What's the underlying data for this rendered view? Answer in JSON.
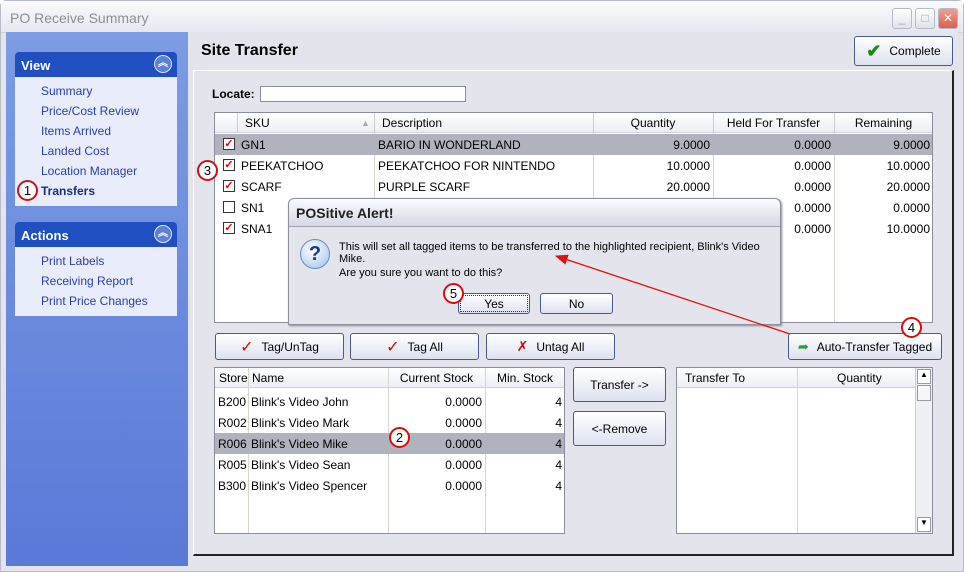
{
  "window": {
    "title": "PO Receive Summary"
  },
  "sidebar": {
    "view": {
      "title": "View",
      "items": [
        "Summary",
        "Price/Cost Review",
        "Items Arrived",
        "Landed Cost",
        "Location Manager",
        "Transfers"
      ]
    },
    "actions": {
      "title": "Actions",
      "items": [
        "Print Labels",
        "Receiving Report",
        "Print Price Changes"
      ]
    }
  },
  "main": {
    "title": "Site Transfer",
    "complete_label": "Complete",
    "locate_label": "Locate:",
    "locate_value": "",
    "items_grid": {
      "columns": [
        "SKU",
        "Description",
        "Quantity",
        "Held For Transfer",
        "Remaining"
      ],
      "rows": [
        {
          "checked": true,
          "sku": "GN1",
          "description": "BARIO IN WONDERLAND",
          "quantity": "9.0000",
          "held": "0.0000",
          "remaining": "9.0000",
          "selected": true
        },
        {
          "checked": true,
          "sku": "PEEKATCHOO",
          "description": "PEEKATCHOO FOR NINTENDO",
          "quantity": "10.0000",
          "held": "0.0000",
          "remaining": "10.0000"
        },
        {
          "checked": true,
          "sku": "SCARF",
          "description": "PURPLE SCARF",
          "quantity": "20.0000",
          "held": "0.0000",
          "remaining": "20.0000"
        },
        {
          "checked": false,
          "sku": "SN1",
          "description": "",
          "quantity": "",
          "held": "0.0000",
          "remaining": "0.0000"
        },
        {
          "checked": true,
          "sku": "SNA1",
          "description": "",
          "quantity": "",
          "held": "0.0000",
          "remaining": "10.0000"
        }
      ]
    },
    "buttons": {
      "tag_untag": "Tag/UnTag",
      "tag_all": "Tag All",
      "untag_all": "Untag All",
      "auto_transfer": "Auto-Transfer Tagged",
      "transfer": "Transfer ->",
      "remove": "<-Remove"
    },
    "stores_grid": {
      "columns": [
        "Store",
        "Name",
        "Current Stock",
        "Min. Stock"
      ],
      "rows": [
        {
          "store": "B200",
          "name": "Blink's Video John",
          "stock": "0.0000",
          "min": "4"
        },
        {
          "store": "R002",
          "name": "Blink's Video Mark",
          "stock": "0.0000",
          "min": "4"
        },
        {
          "store": "R006",
          "name": "Blink's Video Mike",
          "stock": "0.0000",
          "min": "4",
          "selected": true
        },
        {
          "store": "R005",
          "name": "Blink's Video Sean",
          "stock": "0.0000",
          "min": "4"
        },
        {
          "store": "B300",
          "name": "Blink's Video Spencer",
          "stock": "0.0000",
          "min": "4"
        }
      ]
    },
    "transfer_grid": {
      "columns": [
        "Transfer To",
        "Quantity"
      ]
    }
  },
  "dialog": {
    "title": "POSitive Alert!",
    "message": "This will set all tagged items to be transferred to the highlighted recipient, Blink's Video Mike.",
    "question": "Are you sure you want to do this?",
    "yes": "Yes",
    "no": "No",
    "icon": "question-icon"
  },
  "annotations": [
    "1",
    "2",
    "3",
    "4",
    "5"
  ],
  "colors": {
    "sidebar_header": "#1f4fc0",
    "selection": "#b0b2be",
    "annotation": "#d01010"
  }
}
